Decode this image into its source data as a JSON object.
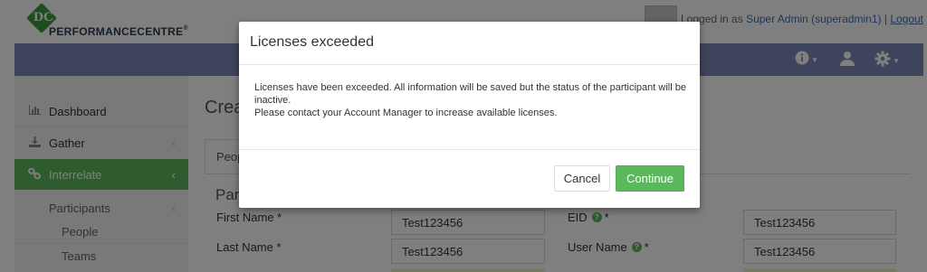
{
  "header": {
    "logo": {
      "mark": "DC",
      "brand": "PERFORMANCECENTRE",
      "reg": "®"
    },
    "login": {
      "prefix": "Logged in as",
      "user": "Super Admin (superadmin1)",
      "separator": "|",
      "logout": "Logout"
    }
  },
  "navbar": {
    "icons": [
      {
        "name": "info-icon",
        "has_dropdown": true
      },
      {
        "name": "user-icon",
        "has_dropdown": false
      },
      {
        "name": "gear-icon",
        "has_dropdown": true
      }
    ]
  },
  "sidebar": {
    "items": [
      {
        "label": "Dashboard",
        "icon": "bar-chart-icon"
      },
      {
        "label": "Gather",
        "icon": "download-icon",
        "chevron": "‹"
      },
      {
        "label": "Interrelate",
        "icon": "link-icon",
        "chevron": "‹",
        "active": true
      }
    ],
    "sub": {
      "group": "Participants",
      "group_chevron": "‹",
      "items": [
        {
          "label": "People"
        },
        {
          "label": "Teams"
        }
      ]
    }
  },
  "main": {
    "title": "Create",
    "tab": "People",
    "section": "Participant",
    "fields": {
      "first_name": {
        "label": "First Name *",
        "value": "Test123456"
      },
      "last_name": {
        "label": "Last Name *",
        "value": "Test123456"
      },
      "eid": {
        "label": "EID",
        "help": "?",
        "required": "*",
        "value": "Test123456"
      },
      "user_name": {
        "label": "User Name",
        "help": "?",
        "required": "*",
        "value": "Test123456"
      }
    }
  },
  "modal": {
    "title": "Licenses exceeded",
    "body_line1": "Licenses have been exceeded. All information will be saved but the status of the participant will be inactive.",
    "body_line2": "Please contact your Account Manager to increase available licenses.",
    "cancel_label": "Cancel",
    "continue_label": "Continue"
  },
  "colors": {
    "navbar": "#7c89b8",
    "accent_green": "#5cb85c",
    "link_blue": "#3a6db5",
    "overlay": "rgba(0,0,0,0.5)"
  }
}
